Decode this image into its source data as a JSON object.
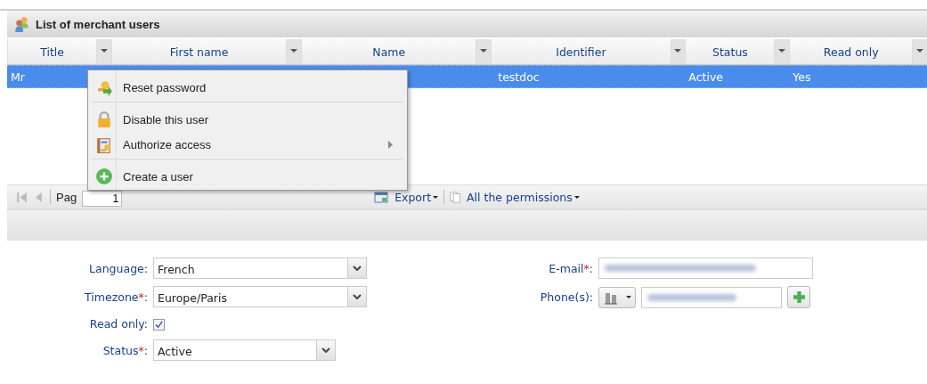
{
  "panel": {
    "title": "List of merchant users"
  },
  "columns": [
    {
      "label": "Title"
    },
    {
      "label": "First name"
    },
    {
      "label": "Name"
    },
    {
      "label": "Identifier"
    },
    {
      "label": "Status"
    },
    {
      "label": "Read only"
    }
  ],
  "rows": [
    {
      "selected": true,
      "cells": [
        "Mr",
        null,
        null,
        "testdoc",
        "Active",
        "Yes"
      ]
    }
  ],
  "context_menu": {
    "items": [
      {
        "label": "Reset password",
        "separator_after": true,
        "submenu": false
      },
      {
        "label": "Disable this user",
        "separator_after": false,
        "submenu": false
      },
      {
        "label": "Authorize access",
        "separator_after": true,
        "submenu": true
      },
      {
        "label": "Create a user",
        "separator_after": false,
        "submenu": false
      }
    ]
  },
  "toolbar": {
    "page_label": "Pag",
    "page_value": "1",
    "export": "Export",
    "permissions": "All the permissions"
  },
  "form": {
    "left": [
      {
        "kind": "select",
        "label": "Language",
        "colon": ":",
        "value": "French"
      },
      {
        "kind": "select",
        "label": "Timezone",
        "required_mark": "*",
        "colon": ":",
        "value": "Europe/Paris"
      },
      {
        "kind": "checkbox",
        "label": "Read only",
        "colon": ":",
        "checked": true
      },
      {
        "kind": "select_short",
        "label": "Status",
        "required_mark": "*",
        "colon": ":",
        "value": "Active"
      }
    ],
    "right": [
      {
        "kind": "email",
        "label": "E-mail",
        "required_mark": "*",
        "colon": ":"
      },
      {
        "kind": "phone",
        "label": "Phone(s)",
        "colon": ":"
      }
    ]
  }
}
